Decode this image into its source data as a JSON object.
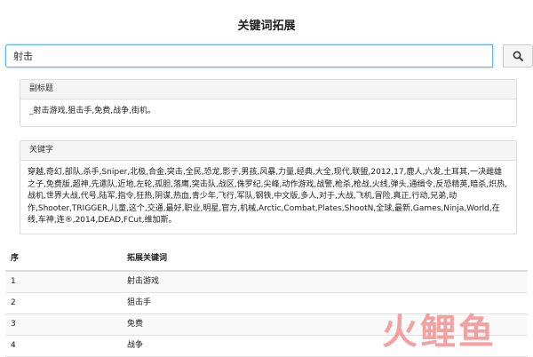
{
  "page": {
    "title": "关键词拓展"
  },
  "search": {
    "value": "射击",
    "button_icon": "search-icon"
  },
  "subtitle_panel": {
    "heading": "副标题",
    "content": "_射击游戏,狙击手,免费,战争,街机。"
  },
  "keywords_panel": {
    "heading": "关键字",
    "content": "穿越,奇幻,部队,杀手,Sniper,北极,合金,突击,全民,恐龙,影子,男孩,风暴,力量,经典,大全,现代,联盟,2012,17,鹿人,六发,土耳其,一决雌雄之子,免费版,超神,先遣队,近地,左轮,孤胆,落鹰,突击队,战区,侏罗纪,尖峰,动作游戏,战警,枪杀,枪战,火线,弹头,通缉令,反恐精英,暗杀,炽热,战机,世界大战,代号,陆军,指令,狂热,阴谋,热血,青少年,飞行,军队,钢铁,中文版,多人,对于,大战,飞机,冒险,真正,行动,兄弟,动作,Shooter,TRIGGER,儿童,这个,交通,最好,职业,明星,官方,机械,Arctic,Combat,Plates,ShootN,全球,最新,Games,Ninja,World,在线,车神,连®,2014,DEAD,FCut,维加斯。"
  },
  "table": {
    "headers": [
      "序",
      "拓展关键词"
    ],
    "rows": [
      {
        "idx": "1",
        "keyword": "射击游戏"
      },
      {
        "idx": "2",
        "keyword": "狙击手"
      },
      {
        "idx": "3",
        "keyword": "免费"
      },
      {
        "idx": "4",
        "keyword": "战争"
      }
    ]
  },
  "watermark": {
    "text": "火鲤鱼"
  },
  "colors": {
    "focus_border": "#66afe9",
    "panel_header_bg": "#f5f5f5",
    "stripe": "#f9f9f9"
  }
}
